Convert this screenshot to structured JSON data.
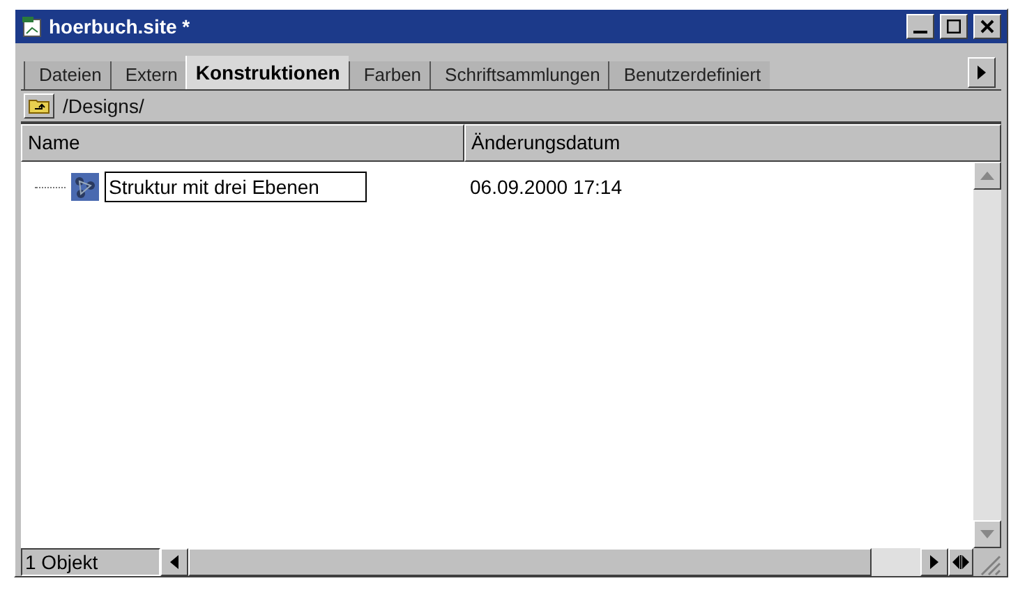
{
  "window": {
    "title": "hoerbuch.site *"
  },
  "tabs": [
    {
      "label": "Dateien",
      "selected": false
    },
    {
      "label": "Extern",
      "selected": false
    },
    {
      "label": "Konstruktionen",
      "selected": true
    },
    {
      "label": "Farben",
      "selected": false
    },
    {
      "label": "Schriftsammlungen",
      "selected": false
    },
    {
      "label": "Benutzerdefiniert",
      "selected": false
    }
  ],
  "path": "/Designs/",
  "table": {
    "columns": [
      "Name",
      "Änderungsdatum"
    ],
    "rows": [
      {
        "name": "Struktur mit drei Ebenen",
        "date": "06.09.2000 17:14",
        "editing": true
      }
    ]
  },
  "status_bar": "1 Objekt"
}
